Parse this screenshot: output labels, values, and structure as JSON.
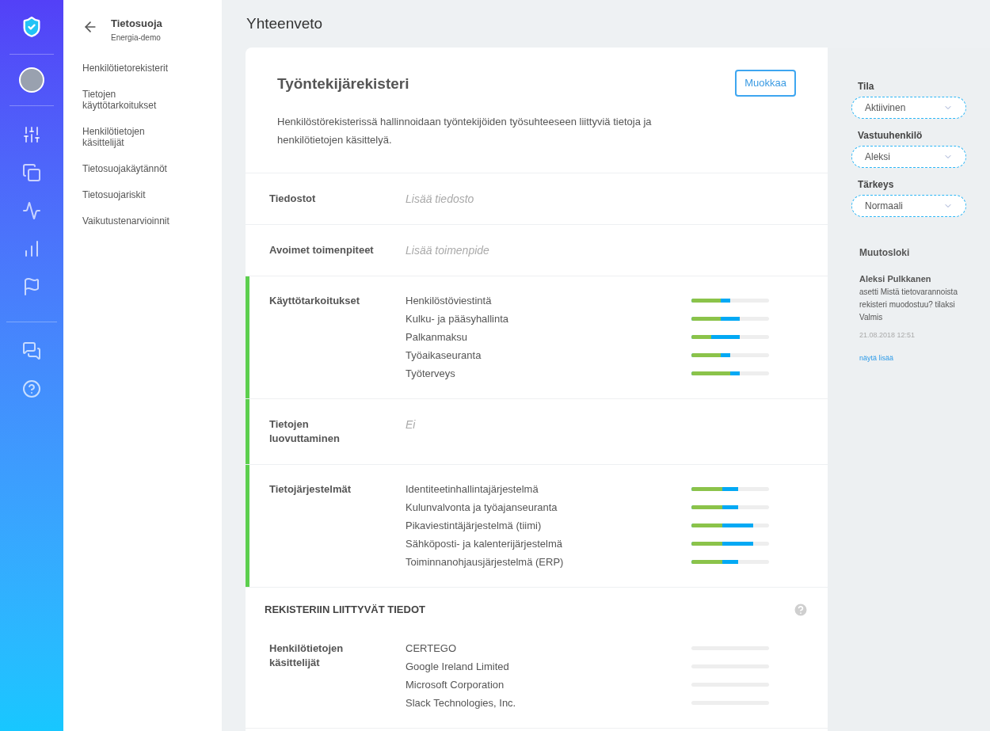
{
  "app_sidebar": {
    "icons": [
      {
        "kind": "logo"
      },
      {
        "kind": "avatar"
      },
      {
        "kind": "sliders"
      },
      {
        "kind": "copies"
      },
      {
        "kind": "pulse"
      },
      {
        "kind": "bars"
      },
      {
        "kind": "flag"
      },
      {
        "kind": "chat"
      },
      {
        "kind": "help"
      }
    ]
  },
  "nav": {
    "title": "Tietosuoja",
    "subtitle": "Energia-demo",
    "items": [
      "Henkilötietorekisterit",
      "Tietojen käyttötarkoitukset",
      "Henkilötietojen käsittelijät",
      "Tietosuojakäytännöt",
      "Tietosuojariskit",
      "Vaikutustenarvioinnit"
    ]
  },
  "page_title": "Yhteenveto",
  "register": {
    "title": "Työntekijärekisteri",
    "edit_button": "Muokkaa",
    "description": "Henkilöstörekisterissä hallinnoidaan työntekijöiden työsuhteeseen liittyviä tietoja ja henkilötietojen käsittelyä.",
    "sections": [
      {
        "label": "Tiedostot",
        "kind": "placeholder",
        "highlighted": false,
        "value": "Lisää tiedosto"
      },
      {
        "label": "Avoimet toimenpiteet",
        "kind": "placeholder",
        "highlighted": false,
        "value": "Lisää toimenpide"
      },
      {
        "label": "Käyttötarkoitukset",
        "kind": "list",
        "highlighted": true,
        "items": [
          {
            "name": "Henkilöstöviestintä",
            "fills": [
              {
                "color": "#03a9f4",
                "level": 0.5
              },
              {
                "color": "#8bc34a",
                "level": 0.38
              }
            ]
          },
          {
            "name": "Kulku- ja pääsyhallinta",
            "fills": [
              {
                "color": "#03a9f4",
                "level": 0.62
              },
              {
                "color": "#8bc34a",
                "level": 0.38
              }
            ]
          },
          {
            "name": "Palkanmaksu",
            "fills": [
              {
                "color": "#03a9f4",
                "level": 0.62
              },
              {
                "color": "#8bc34a",
                "level": 0.25
              }
            ]
          },
          {
            "name": "Työaikaseuranta",
            "fills": [
              {
                "color": "#03a9f4",
                "level": 0.5
              },
              {
                "color": "#8bc34a",
                "level": 0.38
              }
            ]
          },
          {
            "name": "Työterveys",
            "fills": [
              {
                "color": "#03a9f4",
                "level": 0.62
              },
              {
                "color": "#8bc34a",
                "level": 0.5
              }
            ]
          }
        ]
      },
      {
        "label": "Tietojen luovuttaminen",
        "kind": "placeholder",
        "highlighted": true,
        "value": "Ei"
      },
      {
        "label": "Tietojärjestelmät",
        "kind": "list",
        "highlighted": true,
        "items": [
          {
            "name": "Identiteetinhallintajärjestelmä",
            "fills": [
              {
                "color": "#03a9f4",
                "level": 0.6
              },
              {
                "color": "#8bc34a",
                "level": 0.4
              }
            ]
          },
          {
            "name": "Kulunvalvonta ja työajanseuranta",
            "fills": [
              {
                "color": "#03a9f4",
                "level": 0.6
              },
              {
                "color": "#8bc34a",
                "level": 0.4
              }
            ]
          },
          {
            "name": "Pikaviestintäjärjestelmä (tiimi)",
            "fills": [
              {
                "color": "#03a9f4",
                "level": 0.8
              },
              {
                "color": "#8bc34a",
                "level": 0.4
              }
            ]
          },
          {
            "name": "Sähköposti- ja kalenterijärjestelmä",
            "fills": [
              {
                "color": "#03a9f4",
                "level": 0.8
              },
              {
                "color": "#8bc34a",
                "level": 0.4
              }
            ]
          },
          {
            "name": "Toiminnanohjausjärjestelmä (ERP)",
            "fills": [
              {
                "color": "#03a9f4",
                "level": 0.6
              },
              {
                "color": "#8bc34a",
                "level": 0.4
              }
            ]
          }
        ]
      }
    ],
    "related_heading": "REKISTERIIN LIITTYVÄT TIEDOT",
    "related": [
      {
        "label": "Henkilötietojen käsittelijät",
        "kind": "list",
        "highlighted": false,
        "items": [
          {
            "name": "CERTEGO",
            "level": 0
          },
          {
            "name": "Google Ireland Limited",
            "level": 0
          },
          {
            "name": "Microsoft Corporation",
            "level": 0
          },
          {
            "name": "Slack Technologies, Inc.",
            "level": 0
          }
        ]
      }
    ]
  },
  "side_panel": {
    "fields": [
      {
        "label": "Tila",
        "value": "Aktiivinen"
      },
      {
        "label": "Vastuuhenkilö",
        "value": "Aleksi"
      },
      {
        "label": "Tärkeys",
        "value": "Normaali"
      }
    ],
    "log": {
      "title": "Muutosloki",
      "entries": [
        {
          "author": "Aleksi Pulkkanen",
          "text": "asetti Mistä tietovarannoista rekisteri muodostuu? tilaksi Valmis",
          "time": "21.08.2018 12:51"
        }
      ],
      "more_link": "näytä lisää"
    }
  }
}
